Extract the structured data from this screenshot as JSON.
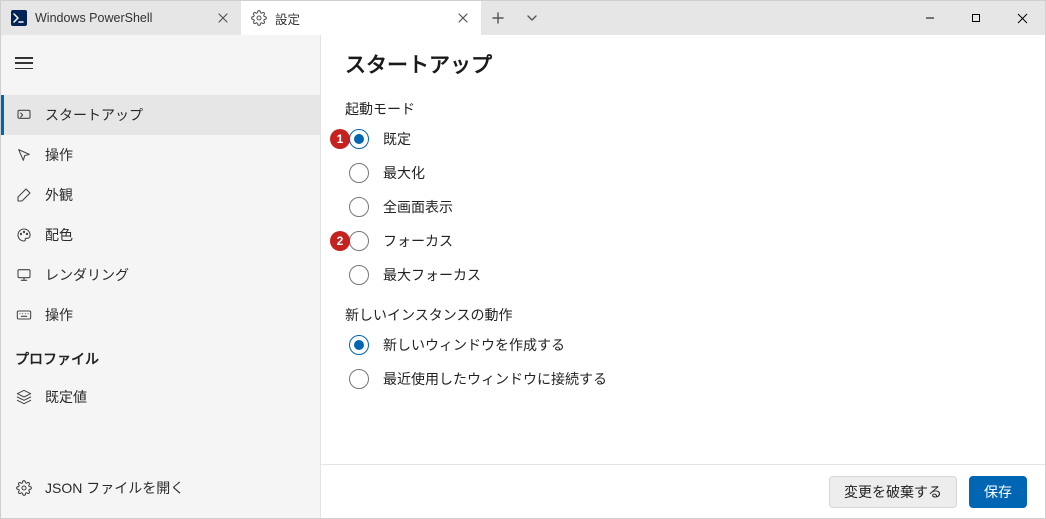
{
  "tabs": [
    {
      "label": "Windows PowerShell"
    },
    {
      "label": "設定"
    }
  ],
  "sidebar": {
    "items": [
      {
        "label": "スタートアップ"
      },
      {
        "label": "操作"
      },
      {
        "label": "外観"
      },
      {
        "label": "配色"
      },
      {
        "label": "レンダリング"
      },
      {
        "label": "操作"
      }
    ],
    "section_label": "プロファイル",
    "profiles": [
      {
        "label": "既定値"
      }
    ],
    "footer_item": {
      "label": "JSON ファイルを開く"
    }
  },
  "content": {
    "page_title": "スタートアップ",
    "launch_mode": {
      "label": "起動モード",
      "options": [
        {
          "label": "既定",
          "selected": true,
          "badge": "1"
        },
        {
          "label": "最大化",
          "selected": false
        },
        {
          "label": "全画面表示",
          "selected": false
        },
        {
          "label": "フォーカス",
          "selected": false,
          "badge": "2"
        },
        {
          "label": "最大フォーカス",
          "selected": false
        }
      ]
    },
    "new_instance": {
      "label": "新しいインスタンスの動作",
      "options": [
        {
          "label": "新しいウィンドウを作成する",
          "selected": true
        },
        {
          "label": "最近使用したウィンドウに接続する",
          "selected": false
        }
      ]
    }
  },
  "footer": {
    "discard_label": "変更を破棄する",
    "save_label": "保存"
  }
}
